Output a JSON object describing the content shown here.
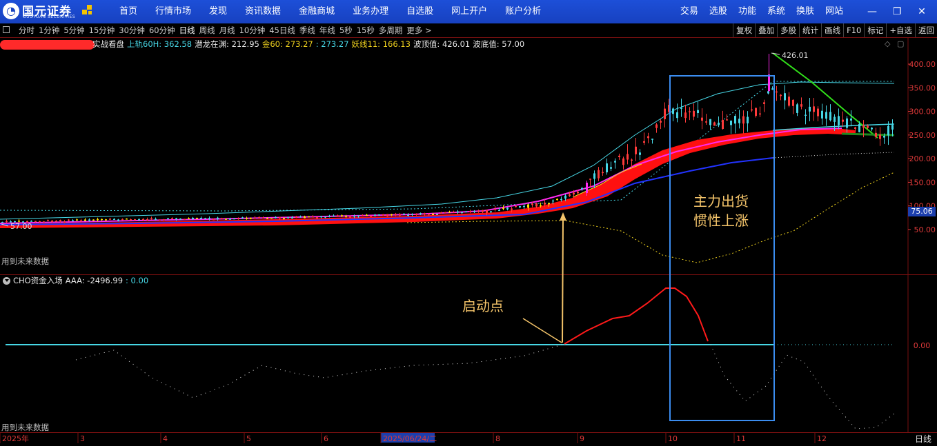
{
  "brand": {
    "name_cn": "国元证券",
    "name_en": "GUOYUAN SECURITIES"
  },
  "nav": {
    "main": [
      "首页",
      "行情市场",
      "发现",
      "资讯数据",
      "金融商城",
      "业务办理",
      "自选股",
      "网上开户",
      "账户分析"
    ],
    "right": [
      "交易",
      "选股",
      "功能",
      "系统",
      "换肤",
      "网站"
    ]
  },
  "periods": [
    "分时",
    "1分钟",
    "5分钟",
    "15分钟",
    "30分钟",
    "60分钟",
    "日线",
    "周线",
    "月线",
    "10分钟",
    "45日线",
    "季线",
    "年线",
    "5秒",
    "15秒",
    "多周期",
    "更多 >"
  ],
  "active_period": "日线",
  "tools": [
    "复权",
    "叠加",
    "多股",
    "统计",
    "画线",
    "F10",
    "标记",
    "+自选",
    "返回"
  ],
  "main_indicator": {
    "name": "实战看盘",
    "items": [
      {
        "label": "上轨60H: 362.58",
        "color": "#47d7e6"
      },
      {
        "label": "潜龙在渊: 212.95",
        "color": "#e8e8e8"
      },
      {
        "label": "金60: 273.27",
        "color": "#f0d21e"
      },
      {
        "label": ": 273.27",
        "color": "#47d7e6"
      },
      {
        "label": "妖线11: 166.13",
        "color": "#f0d21e"
      },
      {
        "label": "波顶值: 426.01",
        "color": "#e8e8e8"
      },
      {
        "label": "波底值: 57.00",
        "color": "#e8e8e8"
      }
    ]
  },
  "sub_indicator": {
    "name": "CHO资金入场",
    "items": [
      {
        "label": "AAA: -2496.99",
        "color": "#e8e8e8"
      },
      {
        "label": ": 0.00",
        "color": "#47d7e6"
      }
    ]
  },
  "future_data_note": "用到未来数据",
  "price_axis": [
    "400.00",
    "350.00",
    "300.00",
    "250.00",
    "200.00",
    "150.00",
    "100.00",
    "50.00"
  ],
  "current_price_tag": "75.06",
  "sub_axis": "0.00",
  "time_axis": {
    "year": "2025年",
    "months": [
      "3",
      "4",
      "5",
      "6",
      "8",
      "9",
      "10",
      "11",
      "12"
    ],
    "cursor_date": "2025/06/24/二"
  },
  "period_footer": "日线",
  "peak_label": "426.01",
  "trough_label": "57.00",
  "annotations": {
    "start_point": "启动点",
    "box_line1": "主力出货",
    "box_line2": "惯性上涨"
  },
  "colors": {
    "nav_bg": "#1741c0",
    "axis_red": "#e03a3a",
    "cyan": "#47d7e6",
    "magenta": "#ff2af0",
    "red_band": "#ff1010",
    "blue_line": "#2233ff",
    "yellow": "#f0d21e",
    "annotation": "#f4c46a",
    "box_blue": "#3b8df0",
    "green_trend": "#31e01a"
  }
}
